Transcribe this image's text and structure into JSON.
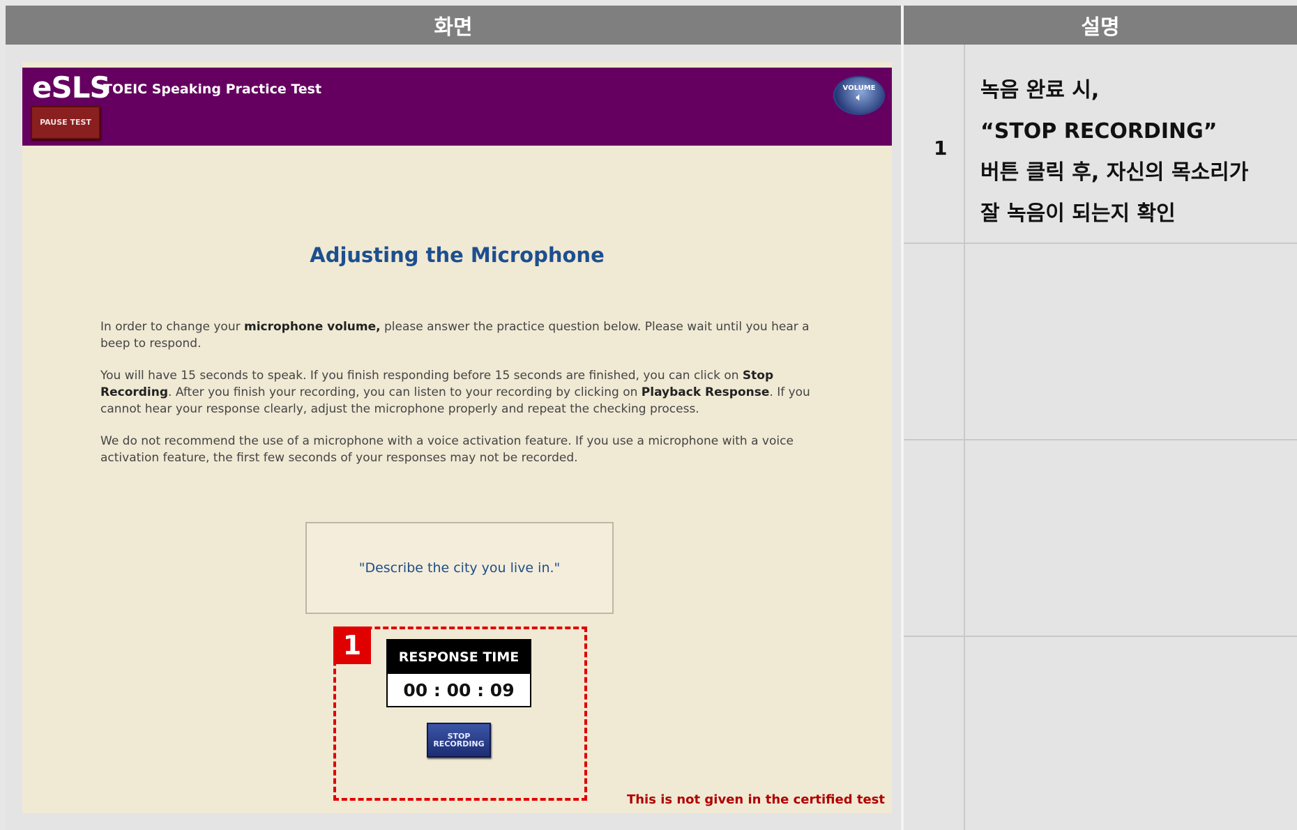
{
  "table": {
    "header_screen": "화면",
    "header_description": "설명"
  },
  "app": {
    "logo": "eSLS",
    "title": "TOEIC Speaking Practice Test",
    "pause_button": "PAUSE TEST",
    "volume_button": "VOLUME",
    "colors": {
      "topbar": "#650060",
      "background": "#f0e9d4",
      "accent_red": "#e00000"
    }
  },
  "content": {
    "heading": "Adjusting the Microphone",
    "p1_a": "In order to change your ",
    "p1_b": "microphone volume,",
    "p1_c": " please answer the practice question below. Please wait until you hear a beep to respond.",
    "p2_a": "You will have 15 seconds to speak. If you finish responding before 15 seconds are finished, you can click on ",
    "p2_b": "Stop Recording",
    "p2_c": ". After you finish your recording, you can listen to your recording by clicking on ",
    "p2_d": "Playback Response",
    "p2_e": ". If you cannot hear your response clearly, adjust the microphone properly and repeat the checking process.",
    "p3": "We do not recommend the use of a microphone with a voice activation feature. If you use a microphone with a voice activation feature, the first few seconds of your responses may not be recorded.",
    "question": "\"Describe the city you live in.\"",
    "response_label": "RESPONSE TIME",
    "response_value": "00 : 00 : 09",
    "stop_button": "STOP RECORDING",
    "note": "This is not given in the certified test"
  },
  "callout": {
    "number": "1"
  },
  "description": {
    "row1_number": "1",
    "line1": "녹음 완료 시,",
    "line2": "“STOP RECORDING”",
    "line3": "버튼 클릭 후, 자신의 목소리가",
    "line4": "잘 녹음이 되는지 확인"
  }
}
